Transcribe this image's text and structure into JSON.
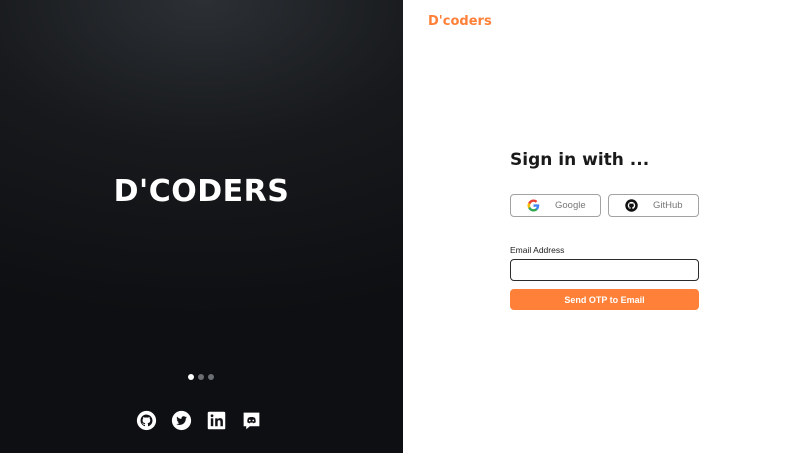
{
  "hero": {
    "title": "D'CODERS"
  },
  "carousel": {
    "count": 3,
    "active_index": 0
  },
  "social": {
    "icons": [
      "github-icon",
      "twitter-icon",
      "linkedin-icon",
      "discord-icon"
    ]
  },
  "brand": {
    "name": "D'coders",
    "color": "#ff8139"
  },
  "signin": {
    "heading": "Sign in with ...",
    "google_label": "Google",
    "github_label": "GitHub",
    "email_label": "Email Address",
    "email_value": "",
    "submit_label": "Send OTP to Email"
  },
  "colors": {
    "accent": "#ff8139",
    "dark_panel": "#0d0f12"
  }
}
